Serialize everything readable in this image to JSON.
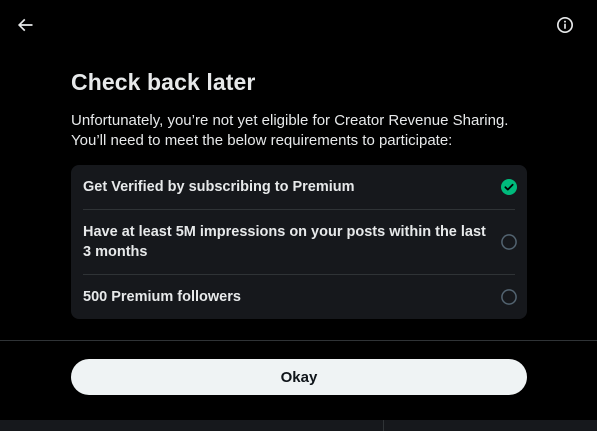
{
  "header": {
    "back_icon": "arrow-left-icon",
    "info_icon": "info-circle-icon"
  },
  "main": {
    "title": "Check back later",
    "description_line1": "Unfortunately, you’re not yet eligible for Creator Revenue Sharing.",
    "description_line2": "You’ll need to meet the below requirements to participate:",
    "requirements": [
      {
        "label": "Get Verified by subscribing to Premium",
        "met": true
      },
      {
        "label": "Have at least 5M impressions on your posts within the last 3 months",
        "met": false
      },
      {
        "label": "500 Premium followers",
        "met": false
      }
    ]
  },
  "footer": {
    "okay_label": "Okay"
  },
  "colors": {
    "background": "#000000",
    "panel": "#16181c",
    "text": "#e7e9ea",
    "check_green": "#00ba7c",
    "button_bg": "#eff3f4"
  }
}
